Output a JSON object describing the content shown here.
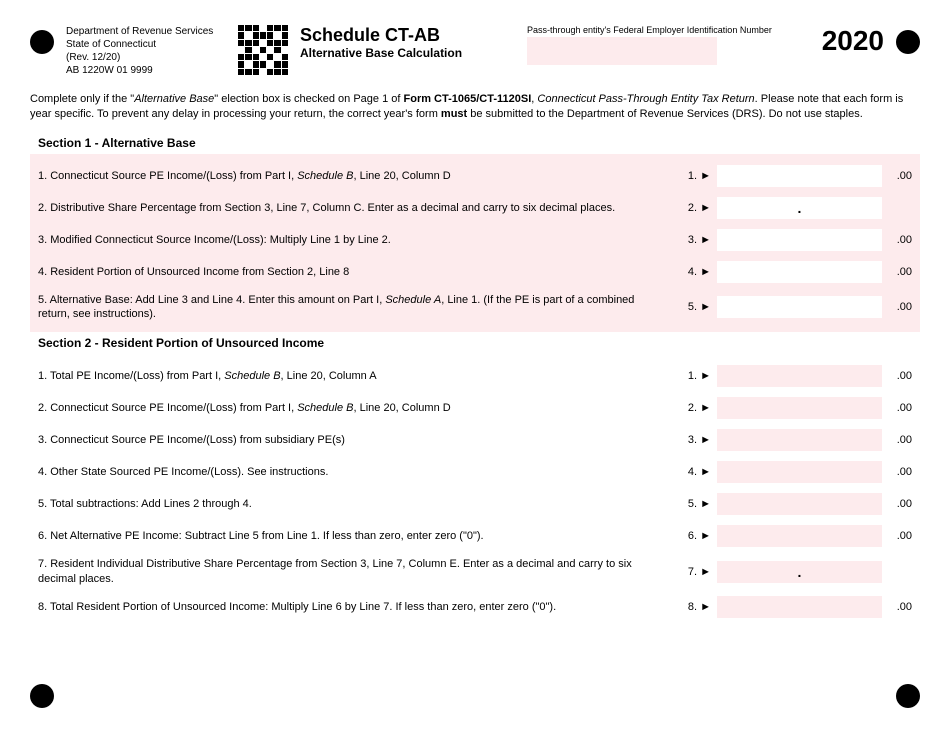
{
  "dept": {
    "line1": "Department of Revenue Services",
    "line2": "State of Connecticut",
    "line3": "(Rev. 12/20)",
    "line4": "AB 1220W 01 9999"
  },
  "title": {
    "main": "Schedule CT-AB",
    "sub": "Alternative Base Calculation"
  },
  "fein_label": "Pass-through entity's Federal Employer Identification Number",
  "year": "2020",
  "instructions": {
    "pre": "Complete only if the \"",
    "ab": "Alternative Base",
    "mid1": "\" election box is checked on Page 1 of ",
    "form": "Form CT-1065/CT-1120SI",
    "mid2": ", ",
    "ret": "Connecticut Pass-Through Entity Tax Return",
    "mid3": ". Please note that each form is year specific. To prevent any delay in processing your return, the correct year's form ",
    "must": "must",
    "post": " be submitted to the Department of Revenue Services (DRS). Do not use staples."
  },
  "section1": {
    "header": "Section 1 - Alternative Base",
    "lines": [
      {
        "n": "1.",
        "desc_pre": "Connecticut Source PE Income/(Loss) from Part I, ",
        "desc_i": "Schedule B",
        "desc_post": ", Line 20, Column D",
        "num": "1. ►",
        "suffix": ".00",
        "dec": false
      },
      {
        "n": "2.",
        "desc_pre": "Distributive Share Percentage from Section 3, Line 7, Column C. Enter as a decimal and carry to six decimal places.",
        "desc_i": "",
        "desc_post": "",
        "num": "2. ►",
        "suffix": "",
        "dec": true
      },
      {
        "n": "3.",
        "desc_pre": "Modified Connecticut Source Income/(Loss): Multiply Line 1 by Line 2.",
        "desc_i": "",
        "desc_post": "",
        "num": "3. ►",
        "suffix": ".00",
        "dec": false
      },
      {
        "n": "4.",
        "desc_pre": "Resident Portion of Unsourced Income from Section 2, Line 8",
        "desc_i": "",
        "desc_post": "",
        "num": "4. ►",
        "suffix": ".00",
        "dec": false
      },
      {
        "n": "5.",
        "desc_pre": "Alternative Base: Add Line 3 and Line 4. Enter this amount on Part I, ",
        "desc_i": "Schedule A",
        "desc_post": ", Line 1. (If the PE is part of a combined return, see instructions).",
        "num": "5. ►",
        "suffix": ".00",
        "dec": false
      }
    ]
  },
  "section2": {
    "header": "Section 2 - Resident Portion of Unsourced Income",
    "lines": [
      {
        "n": "1.",
        "desc_pre": "Total PE Income/(Loss) from Part I, ",
        "desc_i": "Schedule B",
        "desc_post": ", Line 20, Column A",
        "num": "1. ►",
        "suffix": ".00",
        "dec": false
      },
      {
        "n": "2.",
        "desc_pre": "Connecticut Source PE Income/(Loss) from Part I, ",
        "desc_i": "Schedule B",
        "desc_post": ", Line 20, Column D",
        "num": "2. ►",
        "suffix": ".00",
        "dec": false
      },
      {
        "n": "3.",
        "desc_pre": "Connecticut Source PE Income/(Loss) from subsidiary PE(s)",
        "desc_i": "",
        "desc_post": "",
        "num": "3. ►",
        "suffix": ".00",
        "dec": false
      },
      {
        "n": "4.",
        "desc_pre": "Other State Sourced PE Income/(Loss). See instructions.",
        "desc_i": "",
        "desc_post": "",
        "num": "4. ►",
        "suffix": ".00",
        "dec": false
      },
      {
        "n": "5.",
        "desc_pre": "Total subtractions: Add Lines 2 through 4.",
        "desc_i": "",
        "desc_post": "",
        "num": "5. ►",
        "suffix": ".00",
        "dec": false
      },
      {
        "n": "6.",
        "desc_pre": "Net Alternative PE Income: Subtract Line 5 from Line 1. If less than zero, enter zero (\"0\").",
        "desc_i": "",
        "desc_post": "",
        "num": "6. ►",
        "suffix": ".00",
        "dec": false
      },
      {
        "n": "7.",
        "desc_pre": "Resident Individual Distributive Share Percentage from Section 3, Line 7, Column E. Enter as a decimal and carry to six decimal places.",
        "desc_i": "",
        "desc_post": "",
        "num": "7. ►",
        "suffix": "",
        "dec": true
      },
      {
        "n": "8.",
        "desc_pre": "Total Resident Portion of Unsourced Income: Multiply Line 6 by Line 7. If less than zero, enter zero (\"0\").",
        "desc_i": "",
        "desc_post": "",
        "num": "8. ►",
        "suffix": ".00",
        "dec": false
      }
    ]
  }
}
